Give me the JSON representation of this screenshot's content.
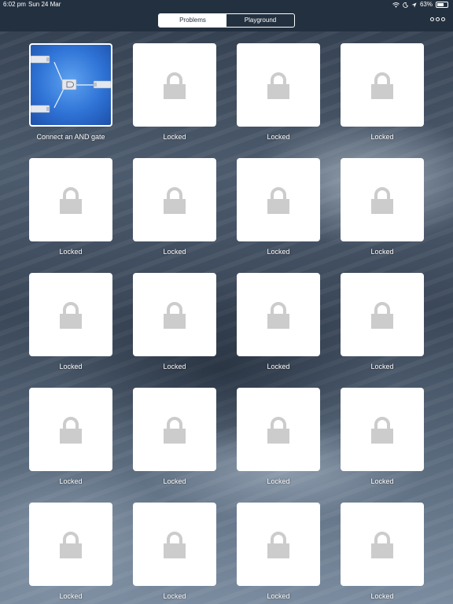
{
  "status_bar": {
    "time": "6:02 pm",
    "date": "Sun 24 Mar",
    "battery_text": "63%",
    "battery_level": 0.63
  },
  "nav": {
    "segments": [
      {
        "label": "Problems",
        "selected": true
      },
      {
        "label": "Playground",
        "selected": false
      }
    ],
    "more_icon": "more-icon"
  },
  "levels": [
    {
      "label": "Connect an AND gate",
      "locked": false,
      "icon": "and-gate-circuit-thumbnail"
    },
    {
      "label": "Locked",
      "locked": true,
      "icon": "padlock-icon"
    },
    {
      "label": "Locked",
      "locked": true,
      "icon": "padlock-icon"
    },
    {
      "label": "Locked",
      "locked": true,
      "icon": "padlock-icon"
    },
    {
      "label": "Locked",
      "locked": true,
      "icon": "padlock-icon"
    },
    {
      "label": "Locked",
      "locked": true,
      "icon": "padlock-icon"
    },
    {
      "label": "Locked",
      "locked": true,
      "icon": "padlock-icon"
    },
    {
      "label": "Locked",
      "locked": true,
      "icon": "padlock-icon"
    },
    {
      "label": "Locked",
      "locked": true,
      "icon": "padlock-icon"
    },
    {
      "label": "Locked",
      "locked": true,
      "icon": "padlock-icon"
    },
    {
      "label": "Locked",
      "locked": true,
      "icon": "padlock-icon"
    },
    {
      "label": "Locked",
      "locked": true,
      "icon": "padlock-icon"
    },
    {
      "label": "Locked",
      "locked": true,
      "icon": "padlock-icon"
    },
    {
      "label": "Locked",
      "locked": true,
      "icon": "padlock-icon"
    },
    {
      "label": "Locked",
      "locked": true,
      "icon": "padlock-icon"
    },
    {
      "label": "Locked",
      "locked": true,
      "icon": "padlock-icon"
    },
    {
      "label": "Locked",
      "locked": true,
      "icon": "padlock-icon"
    },
    {
      "label": "Locked",
      "locked": true,
      "icon": "padlock-icon"
    },
    {
      "label": "Locked",
      "locked": true,
      "icon": "padlock-icon"
    },
    {
      "label": "Locked",
      "locked": true,
      "icon": "padlock-icon"
    }
  ],
  "colors": {
    "nav_background": "#23303f",
    "tile_background": "#ffffff",
    "lock_color": "#cccccc",
    "unlocked_tile": "#2f73d6"
  }
}
